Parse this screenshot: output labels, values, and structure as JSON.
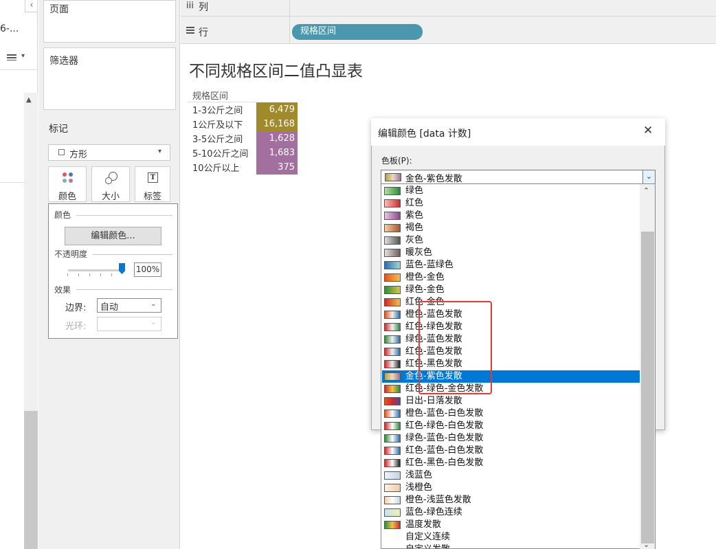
{
  "left_strip": {
    "truncated_text": "6-...",
    "collapse_glyph": "‹",
    "menu_glyph": "▾"
  },
  "pages_card": {
    "title": "页面"
  },
  "filters_card": {
    "title": "筛选器"
  },
  "marks_card": {
    "title": "标记",
    "mark_type": "方形",
    "buttons": [
      {
        "label": "颜色",
        "icon": "dots-icon"
      },
      {
        "label": "大小",
        "icon": "size-icon"
      },
      {
        "label": "标签",
        "icon": "text-label-icon"
      }
    ],
    "color_popup": {
      "color_section": "颜色",
      "edit_button": "编辑颜色...",
      "opacity_label": "不透明度",
      "opacity_value": "100%",
      "opacity_fraction": 1.0,
      "effects_section": "效果",
      "border_label": "边界:",
      "border_value": "自动",
      "halo_label": "光环:",
      "halo_value": ""
    }
  },
  "shelves": {
    "columns_label": "列",
    "rows_label": "行",
    "row_pill": "规格区间"
  },
  "view": {
    "title": "不同规格区间二值凸显表",
    "table_header": "规格区间",
    "rows": [
      {
        "label": "1-3公斤之间",
        "value": "6,479",
        "color": "#a08a2c"
      },
      {
        "label": "1公斤及以下",
        "value": "16,168",
        "color": "#a08a2c"
      },
      {
        "label": "3-5公斤之间",
        "value": "1,628",
        "color": "#a36f9f"
      },
      {
        "label": "5-10公斤之间",
        "value": "1,683",
        "color": "#a36f9f"
      },
      {
        "label": "10公斤以上",
        "value": "375",
        "color": "#a36f9f"
      }
    ]
  },
  "dialog": {
    "title": "编辑颜色 [data 计数]",
    "close_glyph": "✕",
    "palette_label": "色板(P):",
    "selected_palette": "金色-紫色发散",
    "selected_gradient": "linear-gradient(to right,#b8a046,#e8dcc0,#a36f9f)",
    "palettes": [
      {
        "label": "绿色",
        "gradient": "linear-gradient(to right,#b3e0a6,#2e8b3a)"
      },
      {
        "label": "红色",
        "gradient": "linear-gradient(to right,#f9c0b8,#d02a2a)"
      },
      {
        "label": "紫色",
        "gradient": "linear-gradient(to right,#e8c6e0,#8e4a8c)"
      },
      {
        "label": "褐色",
        "gradient": "linear-gradient(to right,#f2d0a8,#a5582a)"
      },
      {
        "label": "灰色",
        "gradient": "linear-gradient(to right,#e0e0e0,#555555)"
      },
      {
        "label": "暖灰色",
        "gradient": "linear-gradient(to right,#e8e0dc,#6b5f5a)"
      },
      {
        "label": "蓝色-蓝绿色",
        "gradient": "linear-gradient(to right,#2a6fb0,#9fd6d6)"
      },
      {
        "label": "橙色-金色",
        "gradient": "linear-gradient(to right,#e8541c,#f2c24a)"
      },
      {
        "label": "绿色-金色",
        "gradient": "linear-gradient(to right,#2e8b3a,#d8c84a)"
      },
      {
        "label": "红色-金色",
        "gradient": "linear-gradient(to right,#d02a2a,#f2c24a)"
      },
      {
        "label": "橙色-蓝色发散",
        "gradient": "linear-gradient(to right,#e8541c,#f0f0f0,#2a6fb0)"
      },
      {
        "label": "红色-绿色发散",
        "gradient": "linear-gradient(to right,#d02a2a,#f0f0f0,#2e8b3a)"
      },
      {
        "label": "绿色-蓝色发散",
        "gradient": "linear-gradient(to right,#2e8b3a,#f0f0f0,#2a6fb0)"
      },
      {
        "label": "红色-蓝色发散",
        "gradient": "linear-gradient(to right,#d02a2a,#f0f0f0,#2a6fb0)"
      },
      {
        "label": "红色-黑色发散",
        "gradient": "linear-gradient(to right,#d02a2a,#f0f0f0,#222222)"
      },
      {
        "label": "金色-紫色发散",
        "gradient": "linear-gradient(to right,#b8a046,#e8dcc0,#a36f9f)"
      },
      {
        "label": "红色-绿色-金色发散",
        "gradient": "linear-gradient(to right,#d02a2a,#f2c24a,#2e8b3a)"
      },
      {
        "label": "日出-日落发散",
        "gradient": "linear-gradient(to right,#e8541c,#d02a2a,#4a4aa0)"
      },
      {
        "label": "橙色-蓝色-白色发散",
        "gradient": "linear-gradient(to right,#e8541c,#ffffff,#2a6fb0)"
      },
      {
        "label": "红色-绿色-白色发散",
        "gradient": "linear-gradient(to right,#d02a2a,#ffffff,#2e8b3a)"
      },
      {
        "label": "绿色-蓝色-白色发散",
        "gradient": "linear-gradient(to right,#2e8b3a,#ffffff,#2a6fb0)"
      },
      {
        "label": "红色-蓝色-白色发散",
        "gradient": "linear-gradient(to right,#d02a2a,#ffffff,#2a6fb0)"
      },
      {
        "label": "红色-黑色-白色发散",
        "gradient": "linear-gradient(to right,#d02a2a,#ffffff,#222222)"
      },
      {
        "label": "浅蓝色",
        "gradient": "linear-gradient(to right,#eef3fa,#c4d4ea)"
      },
      {
        "label": "浅橙色",
        "gradient": "linear-gradient(to right,#fdf0e6,#f6caa6)"
      },
      {
        "label": "橙色-浅蓝色发散",
        "gradient": "linear-gradient(to right,#f6caa6,#ffffff,#c4d4ea)"
      },
      {
        "label": "蓝色-绿色连续",
        "gradient": "linear-gradient(to right,#c4e4f0,#f0f0b0)"
      },
      {
        "label": "温度发散",
        "gradient": "linear-gradient(to right,#2e8b3a,#f2c24a,#d02a2a)"
      },
      {
        "label": "自定义连续",
        "gradient": ""
      },
      {
        "label": "自定义发散",
        "gradient": ""
      }
    ],
    "selected_index": 15
  }
}
